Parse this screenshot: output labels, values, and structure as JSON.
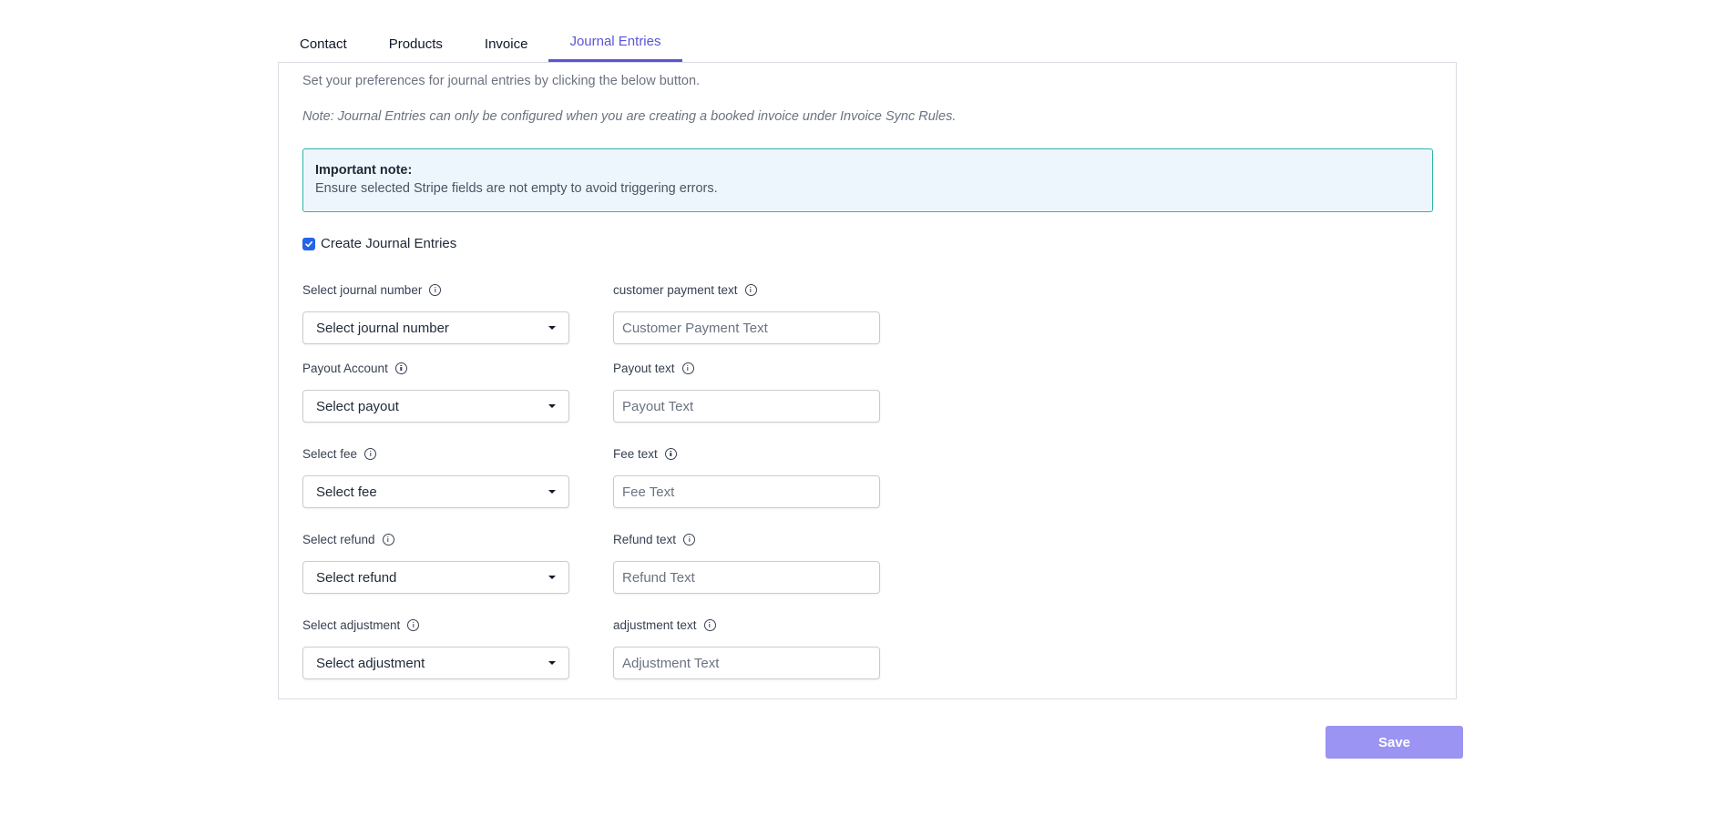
{
  "tabs": [
    {
      "label": "Contact"
    },
    {
      "label": "Products"
    },
    {
      "label": "Invoice"
    },
    {
      "label": "Journal Entries",
      "active": true
    }
  ],
  "intro_text": "Set your preferences for journal entries by clicking the below button.",
  "note_text": "Note: Journal Entries can only be configured when you are creating a booked invoice under Invoice Sync Rules.",
  "alert": {
    "title": "Important note:",
    "body": "Ensure selected Stripe fields are not empty to avoid triggering errors."
  },
  "create_journal_entries": {
    "label": "Create Journal Entries",
    "checked": true
  },
  "fields": {
    "journal_number": {
      "label": "Select journal number",
      "value": "Select journal number"
    },
    "customer_payment_text": {
      "label": "customer payment text",
      "placeholder": "Customer Payment Text"
    },
    "payout_account": {
      "label": "Payout Account",
      "value": "Select payout"
    },
    "payout_text": {
      "label": "Payout text",
      "placeholder": "Payout Text"
    },
    "fee": {
      "label": "Select fee",
      "value": "Select fee"
    },
    "fee_text": {
      "label": "Fee text",
      "placeholder": "Fee Text"
    },
    "refund": {
      "label": "Select refund",
      "value": "Select refund"
    },
    "refund_text": {
      "label": "Refund text",
      "placeholder": "Refund Text"
    },
    "adjustment": {
      "label": "Select adjustment",
      "value": "Select adjustment"
    },
    "adjustment_text": {
      "label": "adjustment text",
      "placeholder": "Adjustment Text"
    }
  },
  "save_label": "Save",
  "colors": {
    "accent": "#5b55d6",
    "save_button": "#9b94f3",
    "alert_background": "#eef6fd",
    "alert_border": "#2fb5a6",
    "checkbox": "#2563eb"
  }
}
